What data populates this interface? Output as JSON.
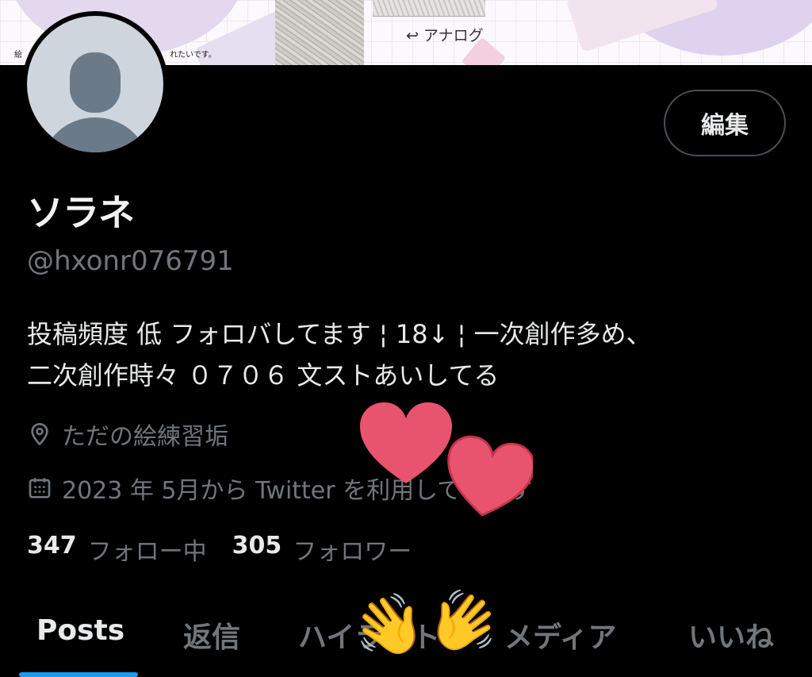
{
  "banner": {
    "caption": "↩ アナログ",
    "caption_left": "絵",
    "caption_right": "れたいです。"
  },
  "profile": {
    "display_name": "ソラネ",
    "handle": "@hxonr076791",
    "bio_line1": "投稿頻度 低 フォロバしてます ¦ 18↓ ¦ 一次創作多め、",
    "bio_line2": "二次創作時々 ０７０６ 文ストあいしてる",
    "location": "ただの絵練習垢",
    "joined": "2023 年 5月から Twitter を利用しています",
    "following_count": "347",
    "following_label": "フォロー中",
    "followers_count": "305",
    "followers_label": "フォロワー"
  },
  "actions": {
    "edit_label": "編集"
  },
  "tabs": [
    {
      "label": "Posts",
      "active": true
    },
    {
      "label": "返信",
      "active": false
    },
    {
      "label": "ハイライト",
      "active": false
    },
    {
      "label": "メディア",
      "active": false
    },
    {
      "label": "いいね",
      "active": false
    }
  ],
  "icons": {
    "location": "location-pin-icon",
    "calendar": "calendar-icon",
    "sticker_heart": "heart-sticker",
    "sticker_wave": "waving-hands-sticker"
  },
  "stickers": {
    "wave": "👋"
  },
  "colors": {
    "accent": "#1d9bf0",
    "muted": "#71767b",
    "heart": "#e8546d"
  }
}
